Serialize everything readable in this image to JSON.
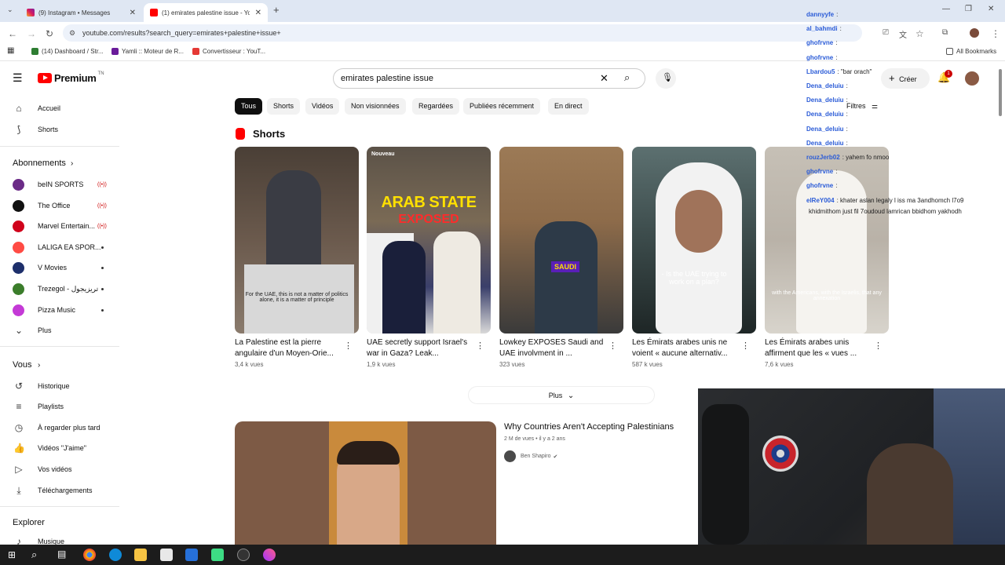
{
  "browser": {
    "tabs": [
      {
        "title": "(9) Instagram • Messages",
        "active": false
      },
      {
        "title": "(1) emirates palestine issue - Yo",
        "active": true
      }
    ],
    "url": "youtube.com/results?search_query=emirates+palestine+issue+",
    "bookmarks": [
      "(14) Dashboard / Str...",
      "Yamli :: Moteur de R...",
      "Convertisseur : YouT...",
      "All Bookmarks"
    ]
  },
  "header": {
    "logo": "Premium",
    "logo_sup": "TN",
    "search_value": "emirates palestine issue",
    "create_label": "Créer",
    "notif_count": "1"
  },
  "sidebar": {
    "main": [
      {
        "label": "Accueil",
        "icon": "home-icon"
      },
      {
        "label": "Shorts",
        "icon": "shorts-icon"
      }
    ],
    "subs_heading": "Abonnements",
    "subs": [
      {
        "label": "beIN SPORTS",
        "color": "#6b2b87",
        "live": true
      },
      {
        "label": "The Office",
        "color": "#111111",
        "live": true
      },
      {
        "label": "Marvel Entertain...",
        "color": "#d0021b",
        "live": true
      },
      {
        "label": "LALIGA EA SPOR...",
        "color": "#ff4b44",
        "live": false
      },
      {
        "label": "V Movies",
        "color": "#1d2f6b",
        "live": false
      },
      {
        "label": "Trezegol - تريزيجول",
        "color": "#3b7d2b",
        "live": false
      },
      {
        "label": "Pizza Music",
        "color": "#c43ad6",
        "live": false
      }
    ],
    "more_label": "Plus",
    "you_heading": "Vous",
    "you": [
      {
        "label": "Historique",
        "icon": "history-icon"
      },
      {
        "label": "Playlists",
        "icon": "playlist-icon"
      },
      {
        "label": "À regarder plus tard",
        "icon": "clock-icon"
      },
      {
        "label": "Vidéos \"J'aime\"",
        "icon": "thumbs-up-icon"
      },
      {
        "label": "Vos vidéos",
        "icon": "video-icon"
      },
      {
        "label": "Téléchargements",
        "icon": "download-icon"
      }
    ],
    "explore_heading": "Explorer",
    "explore": [
      {
        "label": "Musique",
        "icon": "music-icon"
      }
    ]
  },
  "chips": [
    "Tous",
    "Shorts",
    "Vidéos",
    "Non visionnées",
    "Regardées",
    "Publiées récemment",
    "En direct"
  ],
  "filters_label": "Filtres",
  "shorts_heading": "Shorts",
  "shorts": [
    {
      "title": "La Palestine est la pierre angulaire d'un Moyen-Orie...",
      "views": "3,4 k vues",
      "caption": "For the UAE, this is not a matter of politics alone, it is a matter of principle",
      "bg": "#6b5a4d"
    },
    {
      "title": "UAE secretly support Israel's war in Gaza? Leak...",
      "views": "1,9 k vues",
      "caption": "",
      "badge": "Nouveau",
      "overlay1": "ARAB STATE",
      "overlay2": "EXPOSED",
      "bg": "#7a6a55"
    },
    {
      "title": "Lowkey EXPOSES Saudi and UAE involvment in ...",
      "views": "323 vues",
      "caption": "",
      "overlay1": "SAUDI",
      "bg": "#8d6b4a"
    },
    {
      "title": "Les Émirats arabes unis ne voient « aucune alternativ...",
      "views": "587 k vues",
      "caption": "- Is the UAE trying to work on a plan?",
      "bg": "#3b4a4a"
    },
    {
      "title": "Les Émirats arabes unis affirment que les « vues ...",
      "views": "7,6 k vues",
      "caption": "with the Americans, with the Israelis, that any annexation",
      "bg": "#b9b2a8"
    }
  ],
  "plus_label": "Plus",
  "video": {
    "title": "Why Countries Aren't Accepting Palestinians",
    "meta": "2 M de vues • il y a 2 ans",
    "channel": "Ben Shapiro"
  },
  "chat": [
    {
      "user": "dannyyfe",
      "msg": ":"
    },
    {
      "user": "al_bahmdi",
      "msg": ":"
    },
    {
      "user": "ghofrvne",
      "msg": ":"
    },
    {
      "user": "ghofrvne",
      "msg": ":"
    },
    {
      "user": "Lbardou5",
      "msg": ": \"bar orach\""
    },
    {
      "user": "Dena_deluiu",
      "msg": ":"
    },
    {
      "user": "Dena_deluiu",
      "msg": ":"
    },
    {
      "user": "Dena_deluiu",
      "msg": ":"
    },
    {
      "user": "Dena_deluiu",
      "msg": ":"
    },
    {
      "user": "Dena_deluiu",
      "msg": ":"
    },
    {
      "user": "rouzJerb02",
      "msg": ": yahem fo nmoo"
    },
    {
      "user": "ghofrvne",
      "msg": ":"
    },
    {
      "user": "ghofrvne",
      "msg": ":"
    },
    {
      "user": "elReY004",
      "msg": ": khater aslan legaly l iss ma 3andhomch l7o9"
    },
    {
      "user": "",
      "msg": "khidmithom just fil 7oudoud lamrican bbidhom yakhodh"
    }
  ]
}
